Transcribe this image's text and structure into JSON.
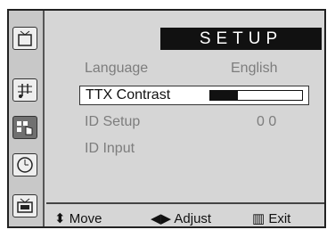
{
  "menu": {
    "title": "SETUP",
    "rows": [
      {
        "label": "Language",
        "value": "English"
      },
      {
        "label": "TTX Contrast",
        "level": 0.3
      },
      {
        "label": "ID Setup",
        "value": "0 0"
      },
      {
        "label": "ID Input"
      }
    ]
  },
  "footer": {
    "move": "⬍ Move",
    "adjust": "◀▶ Adjust",
    "exit": "▥ Exit"
  },
  "icons": [
    "picture-icon",
    "sound-icon",
    "function-icon",
    "clock-icon",
    "pc-icon"
  ]
}
